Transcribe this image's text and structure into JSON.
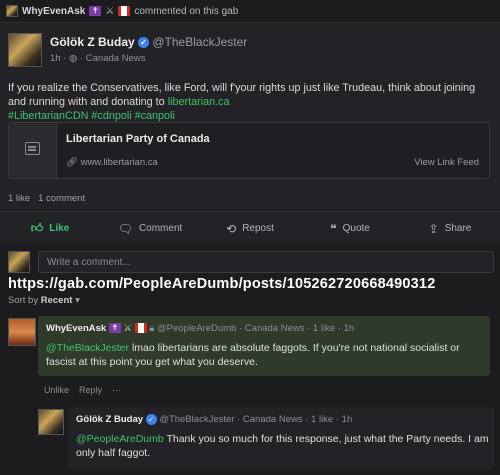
{
  "topbar": {
    "username": "WhyEvenAsk",
    "suffix": "commented on this gab"
  },
  "post": {
    "display_name": "Gölök Z Buday",
    "handle": "@TheBlackJester",
    "time": "1h",
    "group": "Canada News",
    "text_before": "If you realize the Conservatives, like Ford, will f'your rights up just like Trudeau, think about joining and running with and donating to",
    "text_link": "libertarian.ca",
    "hashtags": "#LibertarianCDN #cdnpoli #canpoli",
    "link_card": {
      "title": "Libertarian Party of Canada",
      "url": "www.libertarian.ca",
      "view_label": "View Link Feed"
    },
    "likes": "1 like",
    "comments": "1 comment",
    "actions": {
      "like": "Like",
      "comment": "Comment",
      "repost": "Repost",
      "quote": "Quote",
      "share": "Share"
    }
  },
  "compose": {
    "placeholder": "Write a comment..."
  },
  "overlay_url": "https://gab.com/PeopleAreDumb/posts/105262720668490312",
  "sort": {
    "label": "Sort by",
    "value": "Recent"
  },
  "comment1": {
    "username": "WhyEvenAsk",
    "handle": "@PeopleAreDumb",
    "group": "Canada News",
    "likes": "1 like",
    "time": "1h",
    "mention": "@TheBlackJester",
    "text": "lmao libertarians are absolute faggots. If you're not national socialist or fascist at this point you get what you deserve.",
    "actions": {
      "unlike": "Unlike",
      "reply": "Reply",
      "more": "···"
    }
  },
  "comment2": {
    "display_name": "Gölök Z Buday",
    "handle": "@TheBlackJester",
    "group": "Canada News",
    "likes": "1 like",
    "time": "1h",
    "mention": "@PeopleAreDumb",
    "text": "Thank you so much for this response, just what the Party needs. I am only half faggot."
  },
  "colors": {
    "accent_green": "#3ec46d",
    "verified_blue": "#3b82f6",
    "comment_highlight": "#2f3a2a"
  }
}
